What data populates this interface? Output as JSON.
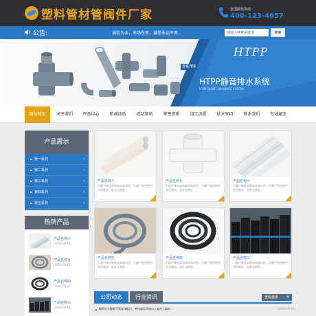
{
  "header": {
    "logo_text": "塑料管材管阀件厂家",
    "hotline_label": "全国服务热线",
    "hotline_number": "400-123-4657"
  },
  "notice": {
    "label": "公告:",
    "text": "诚信为本，市场在变，诚信永远不变..."
  },
  "search": {
    "placeholder": "请输入搜索关键词",
    "button_label": "搜索"
  },
  "banner": {
    "tag": "查看详情",
    "htpp": "HTPP",
    "title": "HTPP静音排水系统",
    "subtitle": "HTPP SILENT DRAINAGE SYSTEM"
  },
  "nav": {
    "items": [
      {
        "label": "网站首页",
        "active": true
      },
      {
        "label": "关于我们"
      },
      {
        "label": "产品中心"
      },
      {
        "label": "新闻动态"
      },
      {
        "label": "成功案例"
      },
      {
        "label": "荣誉资质"
      },
      {
        "label": "加工流程"
      },
      {
        "label": "技术支持"
      },
      {
        "label": "联系我们"
      },
      {
        "label": "在线留言"
      }
    ]
  },
  "sidebar": {
    "products_title": "产品展示",
    "categories": [
      {
        "label": "第一系列"
      },
      {
        "label": "第二系列"
      },
      {
        "label": "第三系列"
      },
      {
        "label": "第四系列"
      },
      {
        "label": "第五系列"
      }
    ],
    "hot_title": "热销产品",
    "hot_items": [
      {
        "name": "产品名称六",
        "date": "(2016-06-01)"
      },
      {
        "name": "产品名称五",
        "date": "(2016-06-01)"
      },
      {
        "name": "产品名称四",
        "date": "(2016-06-01)"
      },
      {
        "name": "产品名称三",
        "date": "(2016-06-01)"
      }
    ]
  },
  "products": [
    {
      "name": "产品名称八",
      "desc": "为客户降低采购成本和风险，为客户提供提供优质服务，追求长期发..."
    },
    {
      "name": "产品名称七",
      "desc": "为客户降低采购成本和风险，为客户提供提供优质服务，追求长期发..."
    },
    {
      "name": "产品名称六",
      "desc": "为客户降低采购成本和风险，为客户提供提供优质服务，追求长期发..."
    },
    {
      "name": "产品名称五",
      "desc": "为客户降低采购成本和风险，为客户提供提供优质服务，追求长期发..."
    },
    {
      "name": "产品名称四",
      "desc": "为客户降低采购成本和风险，为客户提供提供优质服务，追求长期发..."
    },
    {
      "name": "产品名称三",
      "desc": "为客户降低采购成本和风险，为客户提供提供优质服务，追求长期发..."
    }
  ],
  "news": {
    "tab_company": "公司动态",
    "tab_industry": "行业资讯",
    "more_label": "查看更多",
    "items": [
      {
        "title": "做阿生大勤狮了两年快板后，考拉娱乐开始以入女性人群的...",
        "date": "(2016-06-02)"
      }
    ]
  },
  "colors": {
    "accent_blue": "#2b78c5",
    "accent_orange": "#e6a117",
    "dark_header": "#2d2f35",
    "sidebar_gray": "#5b6776"
  }
}
